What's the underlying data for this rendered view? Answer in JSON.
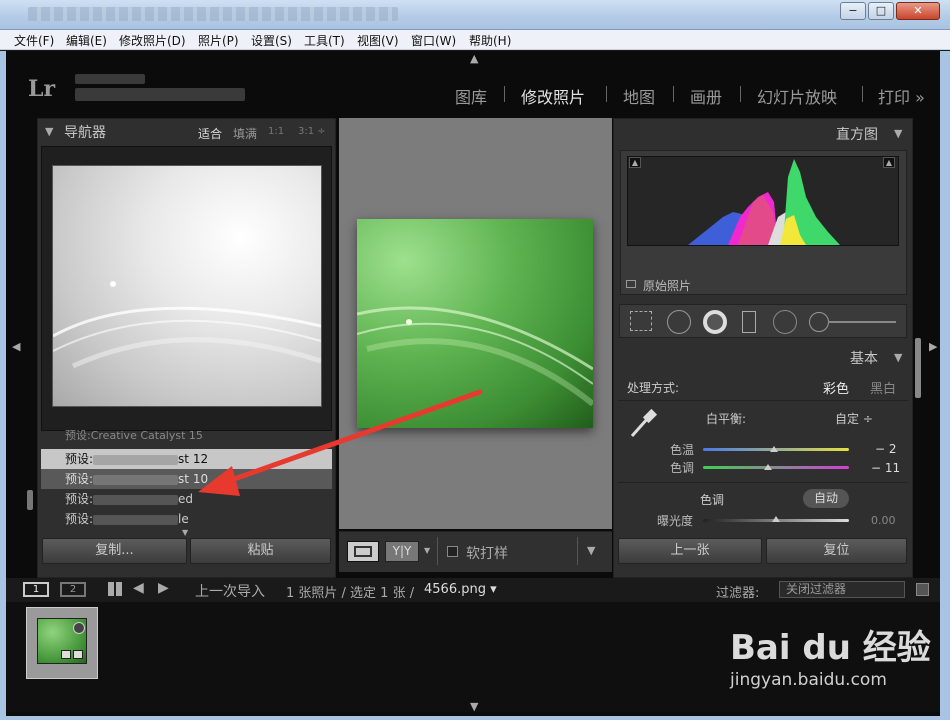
{
  "menubar": [
    "文件(F)",
    "编辑(E)",
    "修改照片(D)",
    "照片(P)",
    "设置(S)",
    "工具(T)",
    "视图(V)",
    "窗口(W)",
    "帮助(H)"
  ],
  "window_buttons": {
    "minimize": "−",
    "maximize": "□",
    "close": "✕"
  },
  "identity": {
    "logo": "Lr"
  },
  "modules": [
    "图库",
    "修改照片",
    "地图",
    "画册",
    "幻灯片放映",
    "打印 »"
  ],
  "left_panel": {
    "navigator_title": "导航器",
    "zoom": [
      "适合",
      "填满",
      "1:1",
      "3:1 ÷"
    ],
    "presets": [
      {
        "label": "预设:",
        "suffix": "Creative Catalyst 15"
      },
      {
        "label": "预设:",
        "suffix": "st 12"
      },
      {
        "label": "预设:",
        "suffix": "st 10"
      },
      {
        "label": "预设:",
        "suffix": "ed"
      },
      {
        "label": "预设:",
        "suffix": "le"
      }
    ],
    "copy_btn": "复制...",
    "paste_btn": "粘贴"
  },
  "center_toolbar": {
    "yy": "Y|Y",
    "softproof": "软打样"
  },
  "right_panel": {
    "histogram_title": "直方图",
    "original_photo": "原始照片",
    "basic_title": "基本",
    "treatment_label": "处理方式:",
    "treatment_color": "彩色",
    "treatment_bw": "黑白",
    "wb_label": "白平衡:",
    "wb_value": "自定 ÷",
    "temp_label": "色温",
    "temp_value": "− 2",
    "tint_label": "色调",
    "tint_value": "− 11",
    "tone_label": "色调",
    "auto_btn": "自动",
    "exposure_label": "曝光度",
    "exposure_value": "0.00",
    "prev_btn": "上一张",
    "reset_btn": "复位"
  },
  "filmbar": {
    "page1": "1",
    "page2": "2",
    "source": "上一次导入",
    "count": "1 张照片 / 选定 1 张 /",
    "filename": "4566.png ▾",
    "filter_label": "过滤器:",
    "filter_value": "关闭过滤器"
  },
  "watermark": {
    "brand": "Bai du 经验",
    "url": "jingyan.baidu.com"
  },
  "colors": {
    "arrow": "#e8392f",
    "active_module": "#e2e2e2"
  }
}
